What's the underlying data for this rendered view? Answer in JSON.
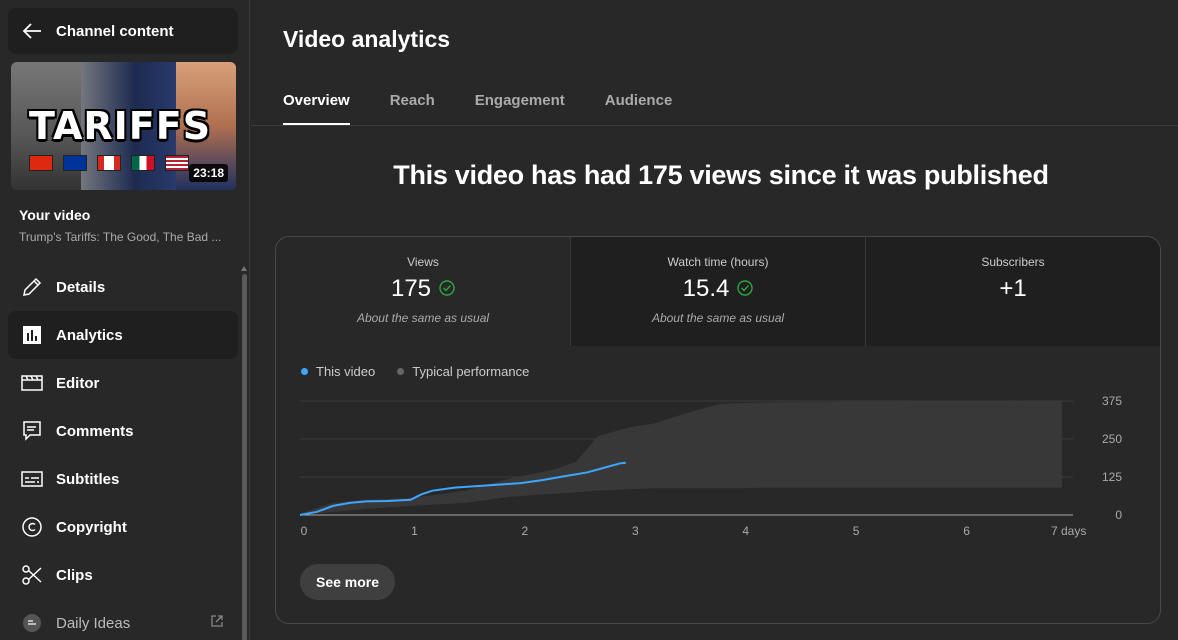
{
  "sidebar": {
    "back_title": "Channel content",
    "thumbnail": {
      "headline": "TARIFFS",
      "duration": "23:18"
    },
    "your_video_label": "Your video",
    "video_title": "Trump's Tariffs: The Good, The Bad ...",
    "items": [
      {
        "label": "Details",
        "icon": "pencil-icon"
      },
      {
        "label": "Analytics",
        "icon": "bar-chart-icon",
        "active": true
      },
      {
        "label": "Editor",
        "icon": "film-icon"
      },
      {
        "label": "Comments",
        "icon": "comment-icon"
      },
      {
        "label": "Subtitles",
        "icon": "subtitles-icon"
      },
      {
        "label": "Copyright",
        "icon": "copyright-icon"
      },
      {
        "label": "Clips",
        "icon": "scissors-icon"
      },
      {
        "label": "Daily Ideas",
        "icon": "daily-ideas-icon"
      }
    ]
  },
  "main": {
    "title": "Video analytics",
    "tabs": [
      "Overview",
      "Reach",
      "Engagement",
      "Audience"
    ],
    "active_tab": "Overview",
    "headline": "This video has had 175 views since it was published",
    "metrics": [
      {
        "label": "Views",
        "value": "175",
        "note": "About the same as usual",
        "check": true
      },
      {
        "label": "Watch time (hours)",
        "value": "15.4",
        "note": "About the same as usual",
        "check": true
      },
      {
        "label": "Subscribers",
        "value": "+1",
        "note": "",
        "check": false
      }
    ],
    "legend": [
      "This video",
      "Typical performance"
    ],
    "see_more": "See more"
  },
  "colors": {
    "this_video": "#3ea6ff",
    "typical_band": "#3a3a3a",
    "check": "#2ba640"
  },
  "chart_data": {
    "type": "line",
    "x_ticks": [
      "0",
      "1",
      "2",
      "3",
      "4",
      "5",
      "6",
      "7 days"
    ],
    "y_ticks": [
      "375",
      "250",
      "125",
      "0"
    ],
    "ylim": [
      0,
      375
    ],
    "xlim": [
      0,
      7
    ],
    "series": [
      {
        "name": "This video",
        "x": [
          0,
          0.15,
          0.3,
          0.45,
          0.6,
          0.8,
          1.0,
          1.1,
          1.2,
          1.4,
          1.6,
          1.8,
          2.0,
          2.2,
          2.4,
          2.6,
          2.75,
          2.9,
          2.95
        ],
        "y": [
          0,
          10,
          30,
          40,
          45,
          46,
          50,
          68,
          80,
          90,
          95,
          100,
          105,
          115,
          128,
          140,
          155,
          170,
          172
        ]
      }
    ],
    "band": {
      "name": "Typical performance",
      "x": [
        0,
        0.3,
        0.6,
        1.0,
        1.5,
        1.9,
        2.3,
        2.5,
        2.7,
        3.0,
        3.2,
        3.5,
        3.8,
        4.0,
        4.2,
        5.0,
        6.0,
        6.9
      ],
      "upper": [
        5,
        40,
        50,
        55,
        80,
        120,
        150,
        175,
        260,
        290,
        300,
        335,
        365,
        368,
        370,
        372,
        374,
        375
      ],
      "lower": [
        0,
        10,
        20,
        30,
        40,
        60,
        70,
        75,
        80,
        85,
        88,
        88,
        88,
        88,
        90,
        90,
        90,
        90
      ]
    }
  }
}
